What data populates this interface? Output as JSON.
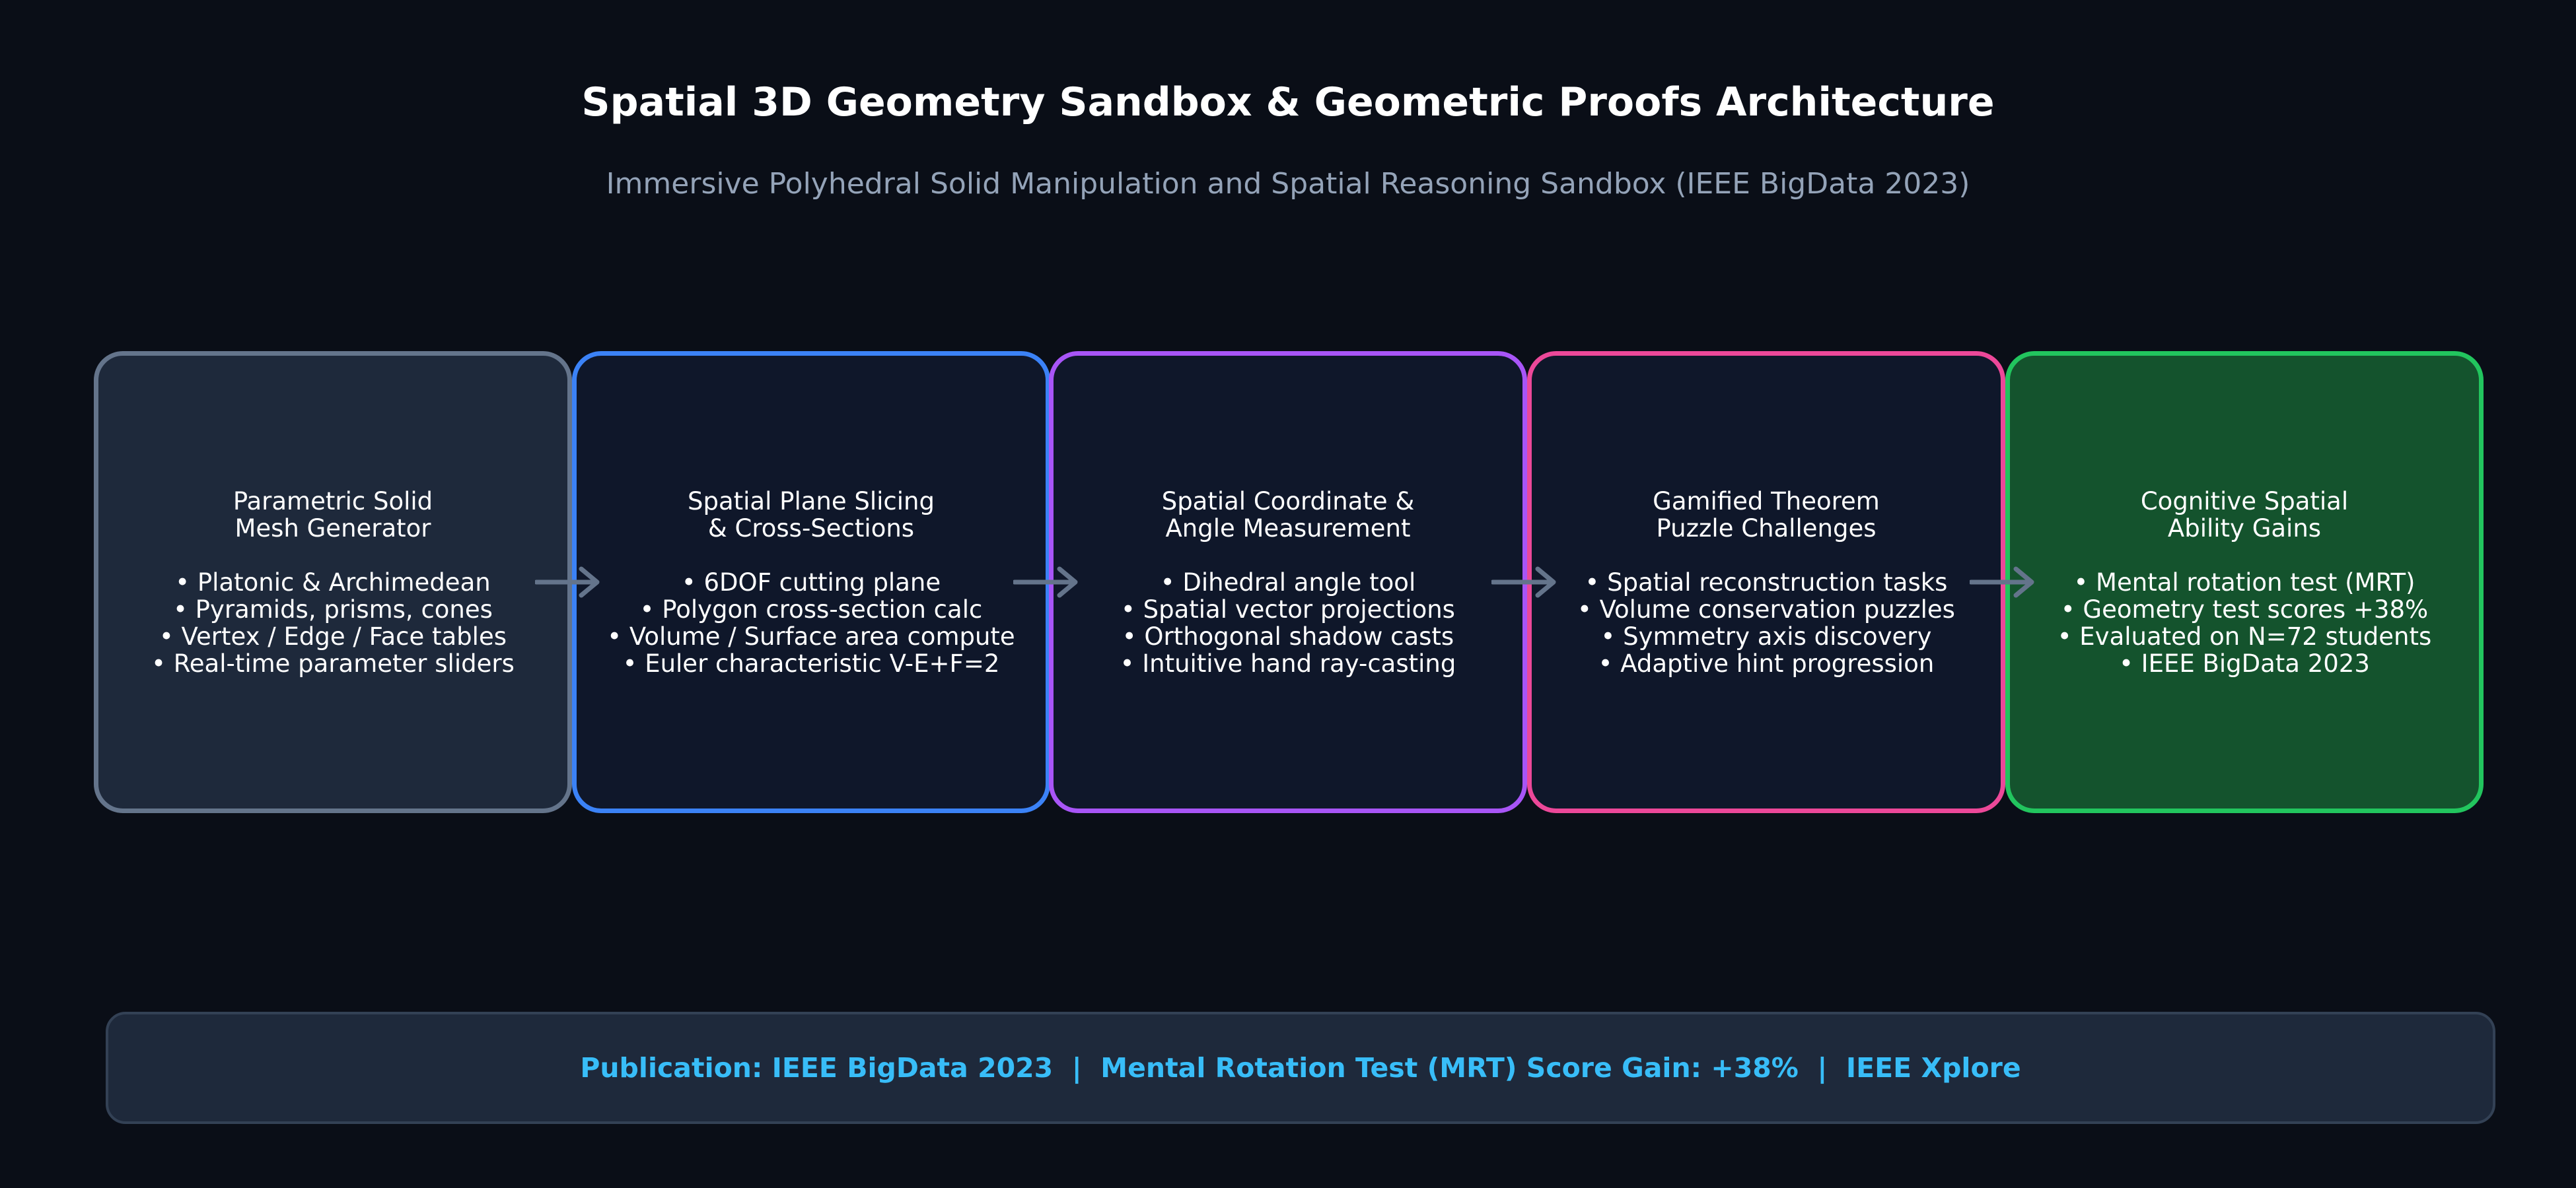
{
  "header": {
    "title": "Spatial 3D Geometry Sandbox & Geometric Proofs Architecture",
    "subtitle": "Immersive Polyhedral Solid Manipulation and Spatial Reasoning Sandbox (IEEE BigData 2023)"
  },
  "stages": [
    {
      "title_lines": [
        "Parametric Solid",
        "Mesh Generator"
      ],
      "bullets": [
        "• Platonic & Archimedean",
        "• Pyramids, prisms, cones",
        "• Vertex / Edge / Face tables",
        "• Real-time parameter sliders"
      ],
      "border_color": "#64748b",
      "fill_color": "#1e293b"
    },
    {
      "title_lines": [
        "Spatial Plane Slicing",
        "& Cross-Sections"
      ],
      "bullets": [
        "• 6DOF cutting plane",
        "• Polygon cross-section calc",
        "• Volume / Surface area compute",
        "• Euler characteristic V-E+F=2"
      ],
      "border_color": "#3b82f6",
      "fill_color": "#0f172a"
    },
    {
      "title_lines": [
        "Spatial Coordinate &",
        "Angle Measurement"
      ],
      "bullets": [
        "• Dihedral angle tool",
        "• Spatial vector projections",
        "• Orthogonal shadow casts",
        "• Intuitive hand ray-casting"
      ],
      "border_color": "#a855f7",
      "fill_color": "#0f172a"
    },
    {
      "title_lines": [
        "Gamified Theorem",
        "Puzzle Challenges"
      ],
      "bullets": [
        "• Spatial reconstruction tasks",
        "• Volume conservation puzzles",
        "• Symmetry axis discovery",
        "• Adaptive hint progression"
      ],
      "border_color": "#ec4899",
      "fill_color": "#0f172a"
    },
    {
      "title_lines": [
        "Cognitive Spatial",
        "Ability Gains"
      ],
      "bullets": [
        "• Mental rotation test (MRT)",
        "• Geometry test scores +38%",
        "• Evaluated on N=72 students",
        "• IEEE BigData 2023"
      ],
      "border_color": "#22c55e",
      "fill_color": "#14532d"
    }
  ],
  "arrow_color": "#64748b",
  "footer": {
    "text": "Publication: IEEE BigData 2023  |  Mental Rotation Test (MRT) Score Gain: +38%  |  IEEE Xplore"
  }
}
